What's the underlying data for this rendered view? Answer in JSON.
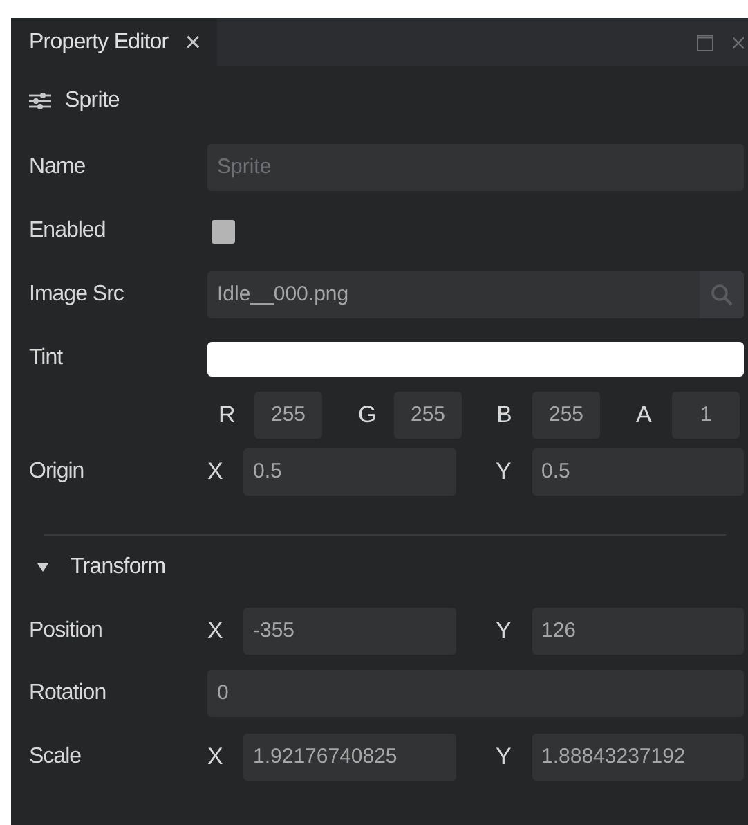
{
  "tab": {
    "label": "Property Editor",
    "close": "×",
    "selected": true
  },
  "sections": [
    {
      "kind": "component",
      "title": "Sprite",
      "rows": [
        {
          "kind": "text",
          "label": "Name",
          "placeholder": "Sprite"
        },
        {
          "kind": "checkbox",
          "label": "Enabled",
          "checked": false
        },
        {
          "kind": "file",
          "label": "Image Src",
          "value": "Idle__000.png"
        },
        {
          "kind": "color",
          "label": "Tint",
          "color": "#ffffff"
        },
        {
          "kind": "channels",
          "parts": [
            {
              "axis": "R",
              "value": "255"
            },
            {
              "axis": "G",
              "value": "255"
            },
            {
              "axis": "B",
              "value": "255"
            },
            {
              "axis": "A",
              "value": "1"
            }
          ]
        },
        {
          "kind": "vector",
          "label": "Origin",
          "parts": [
            {
              "axis": "X",
              "value": "0.5"
            },
            {
              "axis": "Y",
              "value": "0.5"
            }
          ]
        }
      ]
    },
    {
      "kind": "group",
      "title": "Transform",
      "expanded": true,
      "rows": [
        {
          "kind": "vector",
          "label": "Position",
          "parts": [
            {
              "axis": "X",
              "value": "-355"
            },
            {
              "axis": "Y",
              "value": "126"
            }
          ]
        },
        {
          "kind": "text",
          "label": "Rotation",
          "value": "0"
        },
        {
          "kind": "vector",
          "label": "Scale",
          "parts": [
            {
              "axis": "X",
              "value": "1.92176740825"
            },
            {
              "axis": "Y",
              "value": "1.88843237192"
            }
          ]
        }
      ]
    }
  ]
}
